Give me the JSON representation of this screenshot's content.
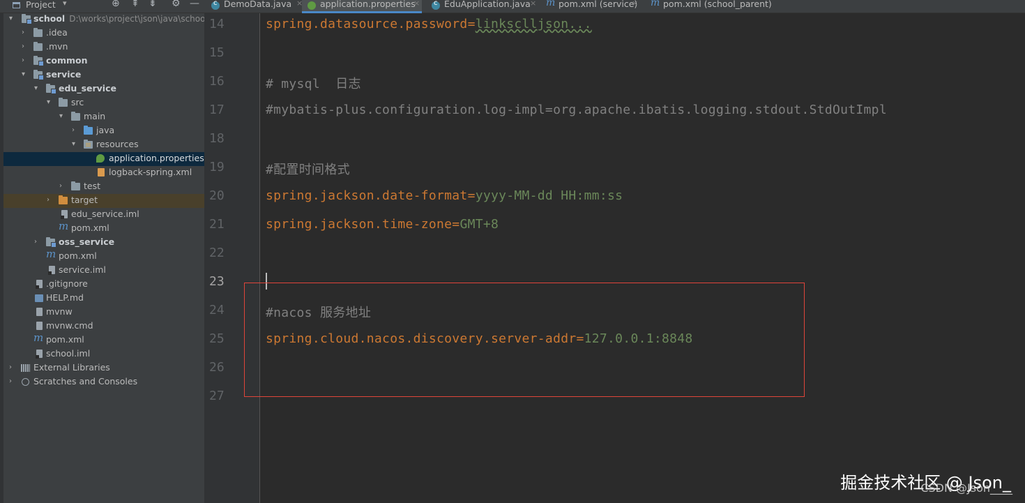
{
  "project_header": {
    "label": "Project"
  },
  "tabs": [
    {
      "label": "DemoData.java",
      "icon": "class-icon",
      "active": false
    },
    {
      "label": "application.properties",
      "icon": "spring-leaf-icon",
      "active": true
    },
    {
      "label": "EduApplication.java",
      "icon": "class-icon",
      "active": false
    },
    {
      "label": "pom.xml (service)",
      "icon": "maven-icon",
      "active": false
    },
    {
      "label": "pom.xml (school_parent)",
      "icon": "maven-icon",
      "active": false
    }
  ],
  "tree": [
    {
      "label": "school",
      "path": "D:\\works\\project\\json\\java\\school",
      "bold": true
    },
    {
      "label": ".idea"
    },
    {
      "label": ".mvn"
    },
    {
      "label": "common",
      "bold": true
    },
    {
      "label": "service",
      "bold": true
    },
    {
      "label": "edu_service",
      "bold": true
    },
    {
      "label": "src"
    },
    {
      "label": "main"
    },
    {
      "label": "java"
    },
    {
      "label": "resources"
    },
    {
      "label": "application.properties"
    },
    {
      "label": "logback-spring.xml"
    },
    {
      "label": "test"
    },
    {
      "label": "target"
    },
    {
      "label": "edu_service.iml"
    },
    {
      "label": "pom.xml"
    },
    {
      "label": "oss_service",
      "bold": true
    },
    {
      "label": "pom.xml"
    },
    {
      "label": "service.iml"
    },
    {
      "label": ".gitignore"
    },
    {
      "label": "HELP.md"
    },
    {
      "label": "mvnw"
    },
    {
      "label": "mvnw.cmd"
    },
    {
      "label": "pom.xml"
    },
    {
      "label": "school.iml"
    },
    {
      "label": "External Libraries"
    },
    {
      "label": "Scratches and Consoles"
    }
  ],
  "editor": {
    "line_numbers": [
      "14",
      "15",
      "16",
      "17",
      "18",
      "19",
      "20",
      "21",
      "22",
      "23",
      "24",
      "25",
      "26",
      "27"
    ],
    "current_line": "23",
    "lines": {
      "l14": {
        "key": "spring.datasource.password",
        "eq": "=",
        "value": "linksclljson..."
      },
      "l16": {
        "comment": "# mysql  日志"
      },
      "l17": {
        "comment": "#mybatis-plus.configuration.log-impl=org.apache.ibatis.logging.stdout.StdOutImpl"
      },
      "l19": {
        "comment": "#配置时间格式"
      },
      "l20": {
        "key": "spring.jackson.date-format",
        "eq": "=",
        "value": "yyyy-MM-dd HH:mm:ss"
      },
      "l21": {
        "key": "spring.jackson.time-zone",
        "eq": "=",
        "value": "GMT+8"
      },
      "l24": {
        "comment": "#nacos 服务地址"
      },
      "l25": {
        "key": "spring.cloud.nacos.discovery.server-addr",
        "eq": "=",
        "value": "127.0.0.1:8848"
      }
    }
  },
  "watermark": {
    "main": "掘金技术社区 @ Json_",
    "sub": "CSDN @Json____"
  },
  "colors": {
    "key": "#cc7832",
    "value": "#6a8759",
    "comment": "#808080",
    "highlight_box": "#e0453a",
    "selection": "#0d293e"
  }
}
